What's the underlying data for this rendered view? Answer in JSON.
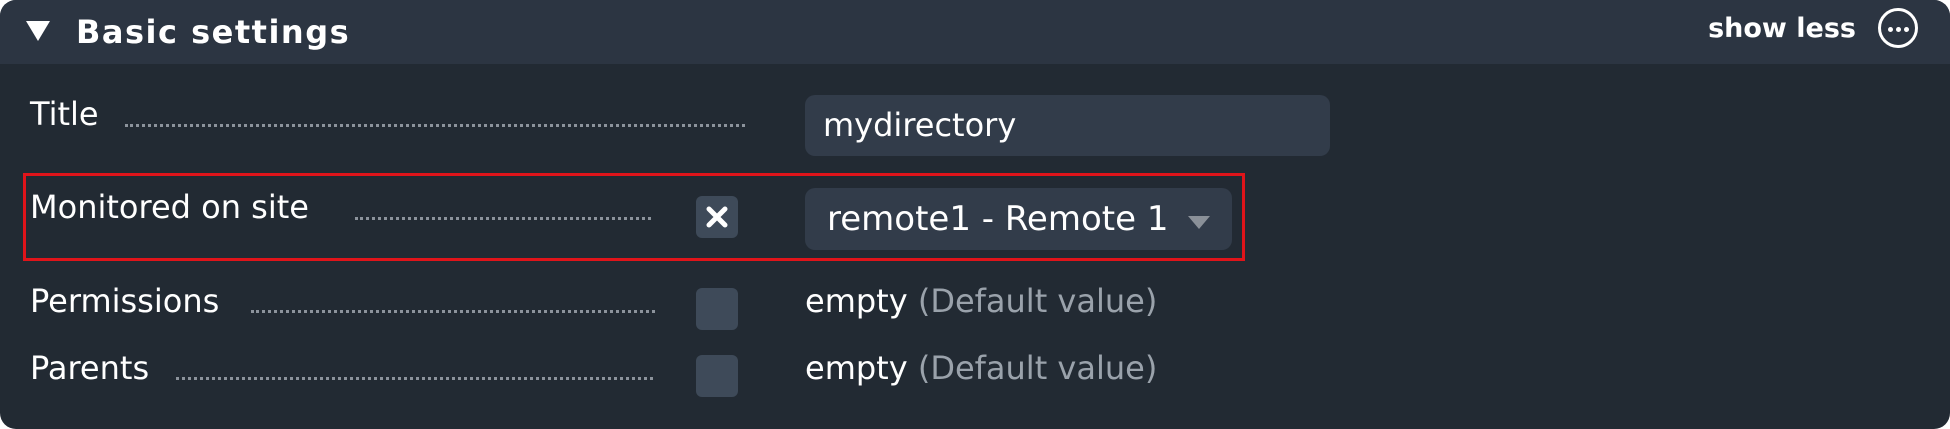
{
  "header": {
    "title": "Basic settings",
    "show_less_label": "show less",
    "toggle_icon": "triangle-down-icon",
    "more_icon": "more-options-icon"
  },
  "rows": [
    {
      "label": "Title",
      "input_value": "mydirectory"
    },
    {
      "label": "Monitored on site",
      "checkbox_checked": true,
      "checkbox_icon": "x-mark-icon",
      "select_value": "remote1 - Remote 1"
    },
    {
      "label": "Permissions",
      "checkbox_checked": false,
      "value": "empty",
      "value_note": "(Default value)"
    },
    {
      "label": "Parents",
      "checkbox_checked": false,
      "value": "empty",
      "value_note": "(Default value)"
    }
  ],
  "colors": {
    "panel_background": "#222a33",
    "header_background": "#2c3542",
    "field_background": "#323c4a",
    "checkbox_background": "#3e4a59",
    "highlight_border": "#e0141a",
    "muted_text": "#9aa2ab"
  }
}
